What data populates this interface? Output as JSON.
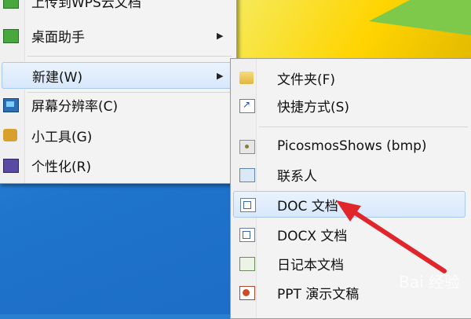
{
  "desktop": {
    "accent": "#2a7fd0"
  },
  "context_menu": {
    "items": [
      {
        "label": "上传到WPS云文档",
        "icon": "wps-cloud-icon"
      },
      {
        "label": "桌面助手",
        "icon": "desktop-assistant-icon",
        "submenu": true
      },
      {
        "label": "新建(W)",
        "icon": "",
        "submenu": true,
        "highlighted": true
      },
      {
        "label": "屏幕分辨率(C)",
        "icon": "monitor-icon"
      },
      {
        "label": "小工具(G)",
        "icon": "gadget-icon"
      },
      {
        "label": "个性化(R)",
        "icon": "personalize-icon"
      }
    ]
  },
  "new_submenu": {
    "items": [
      {
        "label": "文件夹(F)",
        "icon": "folder-icon"
      },
      {
        "label": "快捷方式(S)",
        "icon": "shortcut-icon"
      },
      {
        "label": "PicosmosShows (bmp)",
        "icon": "image-file-icon"
      },
      {
        "label": "联系人",
        "icon": "contact-icon"
      },
      {
        "label": "DOC 文档",
        "icon": "doc-file-icon",
        "highlighted": true
      },
      {
        "label": "DOCX 文档",
        "icon": "docx-file-icon"
      },
      {
        "label": "日记本文档",
        "icon": "journal-file-icon"
      },
      {
        "label": "PPT 演示文稿",
        "icon": "ppt-file-icon"
      }
    ]
  },
  "watermark": {
    "text": "Bai 经验"
  },
  "annotation": {
    "color": "#e0262b",
    "icon": "red-arrow-annotation"
  }
}
